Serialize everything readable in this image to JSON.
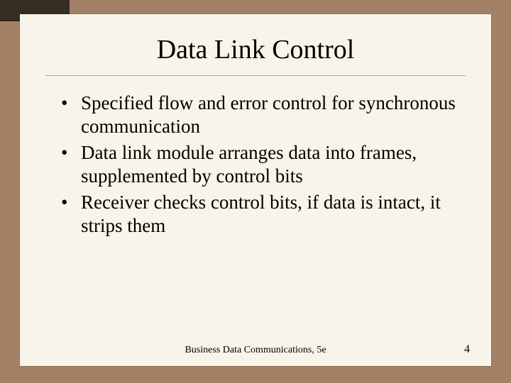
{
  "title": "Data Link Control",
  "bullets": [
    "Specified flow and error control for synchronous communication",
    "Data link module arranges data into frames, supplemented by control bits",
    "Receiver checks control bits, if data is intact, it strips them"
  ],
  "footer": "Business Data Communications, 5e",
  "page": "4"
}
